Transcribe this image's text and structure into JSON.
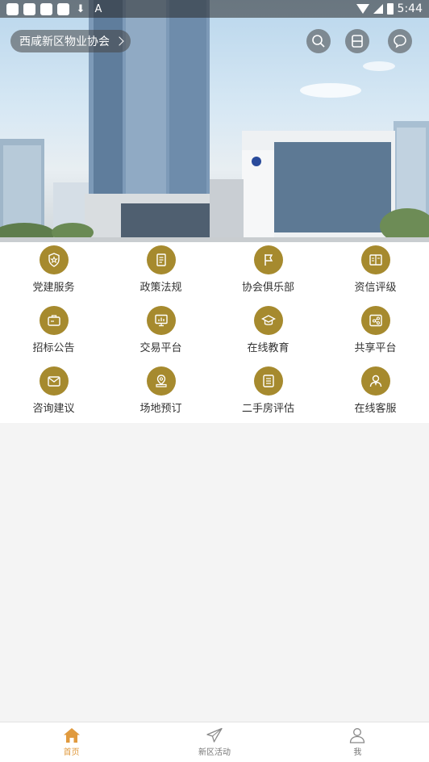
{
  "status_bar": {
    "time": "5:44",
    "download_glyph": "⬇",
    "a_glyph": "A"
  },
  "header": {
    "location": "西咸新区物业协会"
  },
  "top_icons": [
    "search-icon",
    "scan-icon",
    "message-icon"
  ],
  "colors": {
    "icon_gold": "#a68a2e",
    "tab_active": "#e09a3e"
  },
  "grid": [
    {
      "label": "党建服务",
      "icon": "shield-star-icon"
    },
    {
      "label": "政策法规",
      "icon": "document-icon"
    },
    {
      "label": "协会俱乐部",
      "icon": "flag-icon"
    },
    {
      "label": "资信评级",
      "icon": "credit-book-icon"
    },
    {
      "label": "招标公告",
      "icon": "briefcase-icon"
    },
    {
      "label": "交易平台",
      "icon": "monitor-chart-icon"
    },
    {
      "label": "在线教育",
      "icon": "graduation-cap-icon"
    },
    {
      "label": "共享平台",
      "icon": "share-icon"
    },
    {
      "label": "咨询建议",
      "icon": "mail-icon"
    },
    {
      "label": "场地预订",
      "icon": "location-pin-icon"
    },
    {
      "label": "二手房评估",
      "icon": "list-doc-icon"
    },
    {
      "label": "在线客服",
      "icon": "customer-service-icon"
    }
  ],
  "tabs": [
    {
      "label": "首页",
      "icon": "home-icon",
      "active": true
    },
    {
      "label": "新区活动",
      "icon": "paper-plane-icon",
      "active": false
    },
    {
      "label": "我",
      "icon": "user-icon",
      "active": false
    }
  ]
}
